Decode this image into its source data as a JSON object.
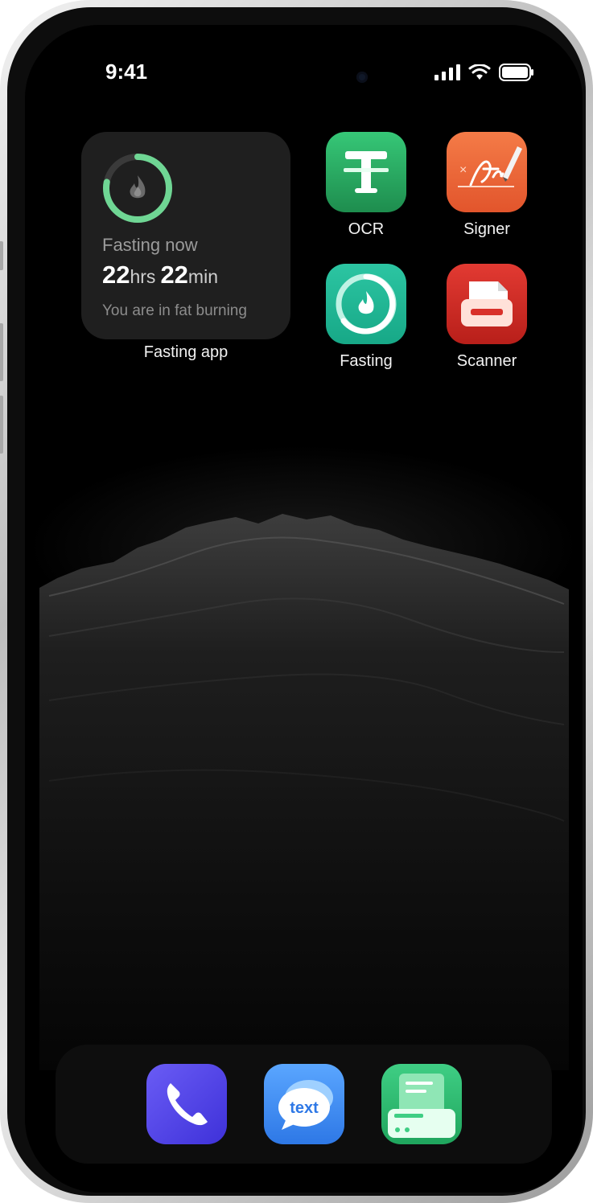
{
  "status_bar": {
    "time": "9:41",
    "icons": [
      "cellular-signal-icon",
      "wifi-icon",
      "battery-icon"
    ]
  },
  "widget": {
    "title": "Fasting now",
    "hours_value": "22",
    "hours_unit": "hrs",
    "minutes_value": "22",
    "minutes_unit": "min",
    "subtitle": "You are in fat burning",
    "label": "Fasting app",
    "progress": 0.78,
    "icon": "flame-icon",
    "ring_color": "#6fd694"
  },
  "apps": [
    {
      "label": "OCR",
      "icon": "ocr-text-icon",
      "color": "#2aa862"
    },
    {
      "label": "Signer",
      "icon": "signature-pen-icon",
      "color": "#f06b3c"
    },
    {
      "label": "Fasting",
      "icon": "fasting-flame-icon",
      "color": "#1fb89a"
    },
    {
      "label": "Scanner",
      "icon": "scanner-icon",
      "color": "#d9302a"
    }
  ],
  "dock": [
    {
      "icon": "phone-icon",
      "color": "#5b4bf0"
    },
    {
      "icon": "text-message-icon",
      "color": "#3f8df0",
      "text": "text"
    },
    {
      "icon": "document-scanner-icon",
      "color": "#2fbf73"
    }
  ]
}
